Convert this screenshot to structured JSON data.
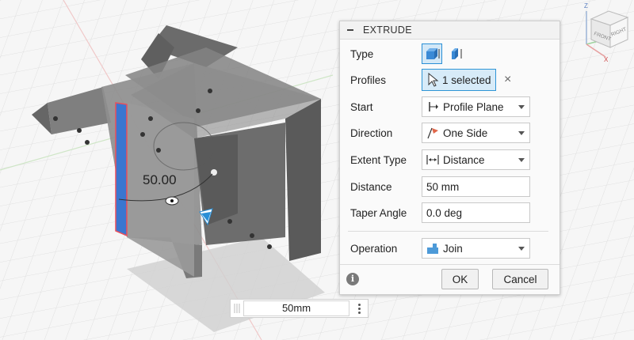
{
  "dialog": {
    "title": "EXTRUDE",
    "type": {
      "label": "Type"
    },
    "profiles": {
      "label": "Profiles",
      "value": "1 selected"
    },
    "start": {
      "label": "Start",
      "value": "Profile Plane"
    },
    "direction": {
      "label": "Direction",
      "value": "One Side"
    },
    "extent_type": {
      "label": "Extent Type",
      "value": "Distance"
    },
    "distance": {
      "label": "Distance",
      "value": "50 mm"
    },
    "taper_angle": {
      "label": "Taper Angle",
      "value": "0.0 deg"
    },
    "operation": {
      "label": "Operation",
      "value": "Join"
    },
    "ok_label": "OK",
    "cancel_label": "Cancel"
  },
  "canvas": {
    "dimension_label": "50.00",
    "dimension_input": "50mm"
  },
  "viewcube": {
    "face_labels": [
      "FRONT",
      "RIGHT"
    ],
    "axis_labels": [
      "Z",
      "Y",
      "X"
    ]
  },
  "colors": {
    "accent": "#2a8fd6",
    "selected_profile": "#3a76d0",
    "body": "#8e8e8e"
  }
}
